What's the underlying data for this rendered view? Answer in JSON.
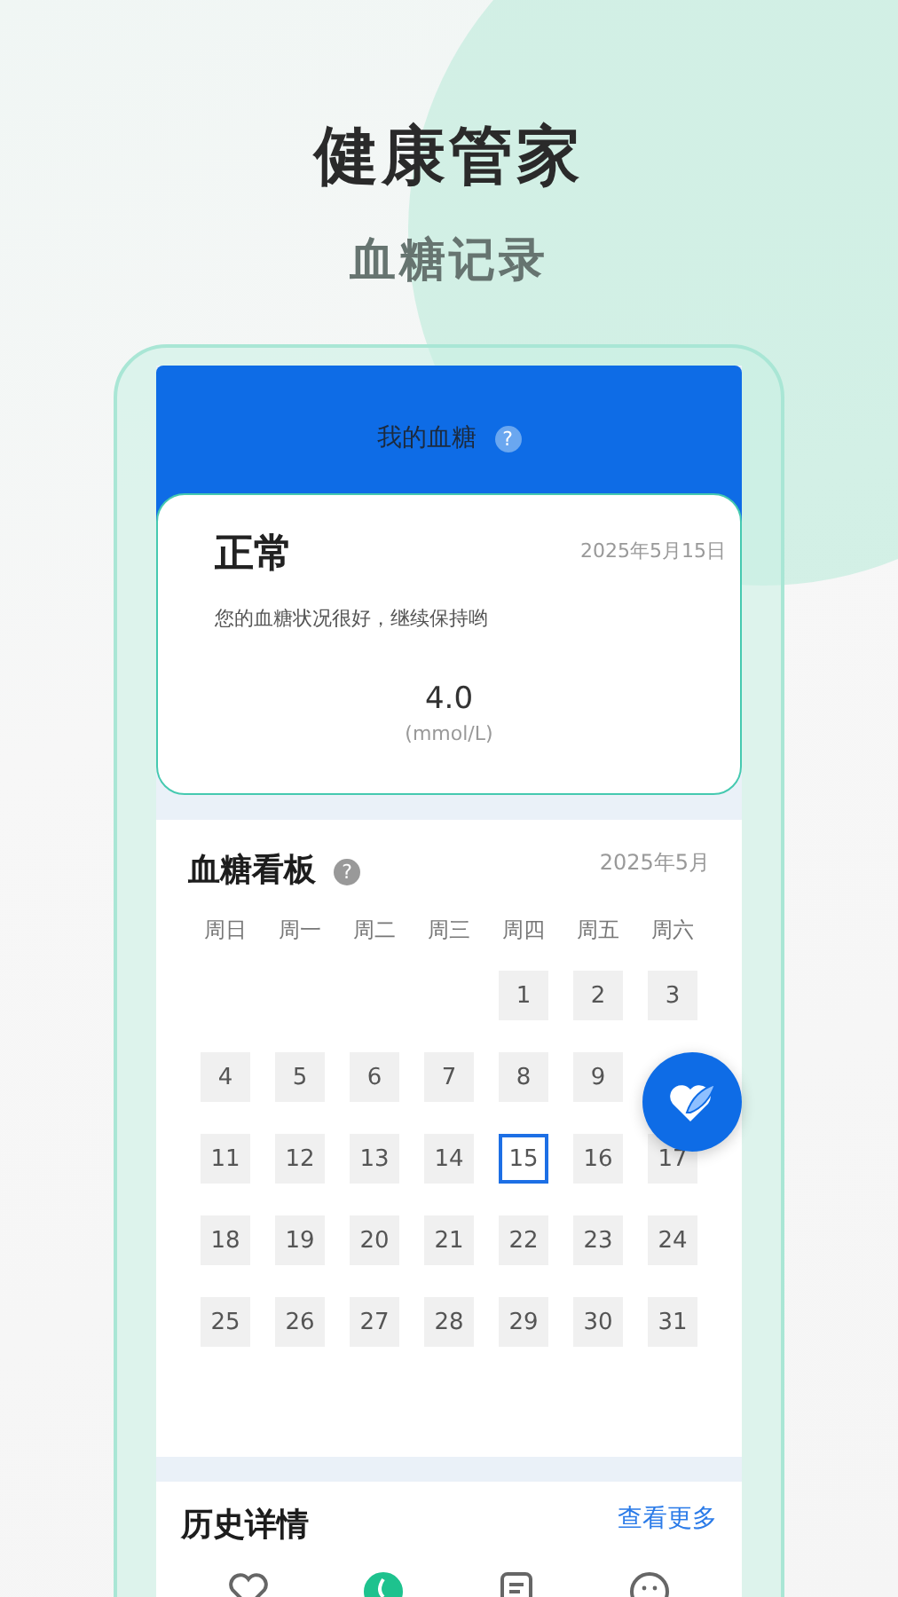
{
  "headline": "健康管家",
  "subheadline": "血糖记录",
  "header": {
    "title": "我的血糖",
    "help": "?"
  },
  "status_card": {
    "status": "正常",
    "date": "2025年5月15日",
    "message": "您的血糖状况很好，继续保持哟",
    "value": "4.0",
    "unit": "(mmol/L)"
  },
  "board": {
    "title": "血糖看板",
    "help": "?",
    "month": "2025年5月",
    "weekdays": [
      "周日",
      "周一",
      "周二",
      "周三",
      "周四",
      "周五",
      "周六"
    ],
    "days": [
      {
        "kind": "blank"
      },
      {
        "kind": "blank"
      },
      {
        "kind": "blank"
      },
      {
        "kind": "blank"
      },
      {
        "kind": "day",
        "label": "1",
        "selected": false
      },
      {
        "kind": "day",
        "label": "2",
        "selected": false
      },
      {
        "kind": "day",
        "label": "3",
        "selected": false
      },
      {
        "kind": "day",
        "label": "4",
        "selected": false
      },
      {
        "kind": "day",
        "label": "5",
        "selected": false
      },
      {
        "kind": "day",
        "label": "6",
        "selected": false
      },
      {
        "kind": "day",
        "label": "7",
        "selected": false
      },
      {
        "kind": "day",
        "label": "8",
        "selected": false
      },
      {
        "kind": "day",
        "label": "9",
        "selected": false
      },
      {
        "kind": "covered"
      },
      {
        "kind": "day",
        "label": "11",
        "selected": false
      },
      {
        "kind": "day",
        "label": "12",
        "selected": false
      },
      {
        "kind": "day",
        "label": "13",
        "selected": false
      },
      {
        "kind": "day",
        "label": "14",
        "selected": false
      },
      {
        "kind": "day",
        "label": "15",
        "selected": true
      },
      {
        "kind": "day",
        "label": "16",
        "selected": false
      },
      {
        "kind": "day",
        "label": "17",
        "selected": false
      },
      {
        "kind": "day",
        "label": "18",
        "selected": false
      },
      {
        "kind": "day",
        "label": "19",
        "selected": false
      },
      {
        "kind": "day",
        "label": "20",
        "selected": false
      },
      {
        "kind": "day",
        "label": "21",
        "selected": false
      },
      {
        "kind": "day",
        "label": "22",
        "selected": false
      },
      {
        "kind": "day",
        "label": "23",
        "selected": false
      },
      {
        "kind": "day",
        "label": "24",
        "selected": false
      },
      {
        "kind": "day",
        "label": "25",
        "selected": false
      },
      {
        "kind": "day",
        "label": "26",
        "selected": false
      },
      {
        "kind": "day",
        "label": "27",
        "selected": false
      },
      {
        "kind": "day",
        "label": "28",
        "selected": false
      },
      {
        "kind": "day",
        "label": "29",
        "selected": false
      },
      {
        "kind": "day",
        "label": "30",
        "selected": false
      },
      {
        "kind": "day",
        "label": "31",
        "selected": false
      }
    ]
  },
  "history": {
    "title": "历史详情",
    "more": "查看更多"
  },
  "nav": [
    {
      "kind": "heart",
      "selected": false
    },
    {
      "kind": "drop",
      "selected": true
    },
    {
      "kind": "note",
      "selected": false
    },
    {
      "kind": "face",
      "selected": false
    }
  ]
}
